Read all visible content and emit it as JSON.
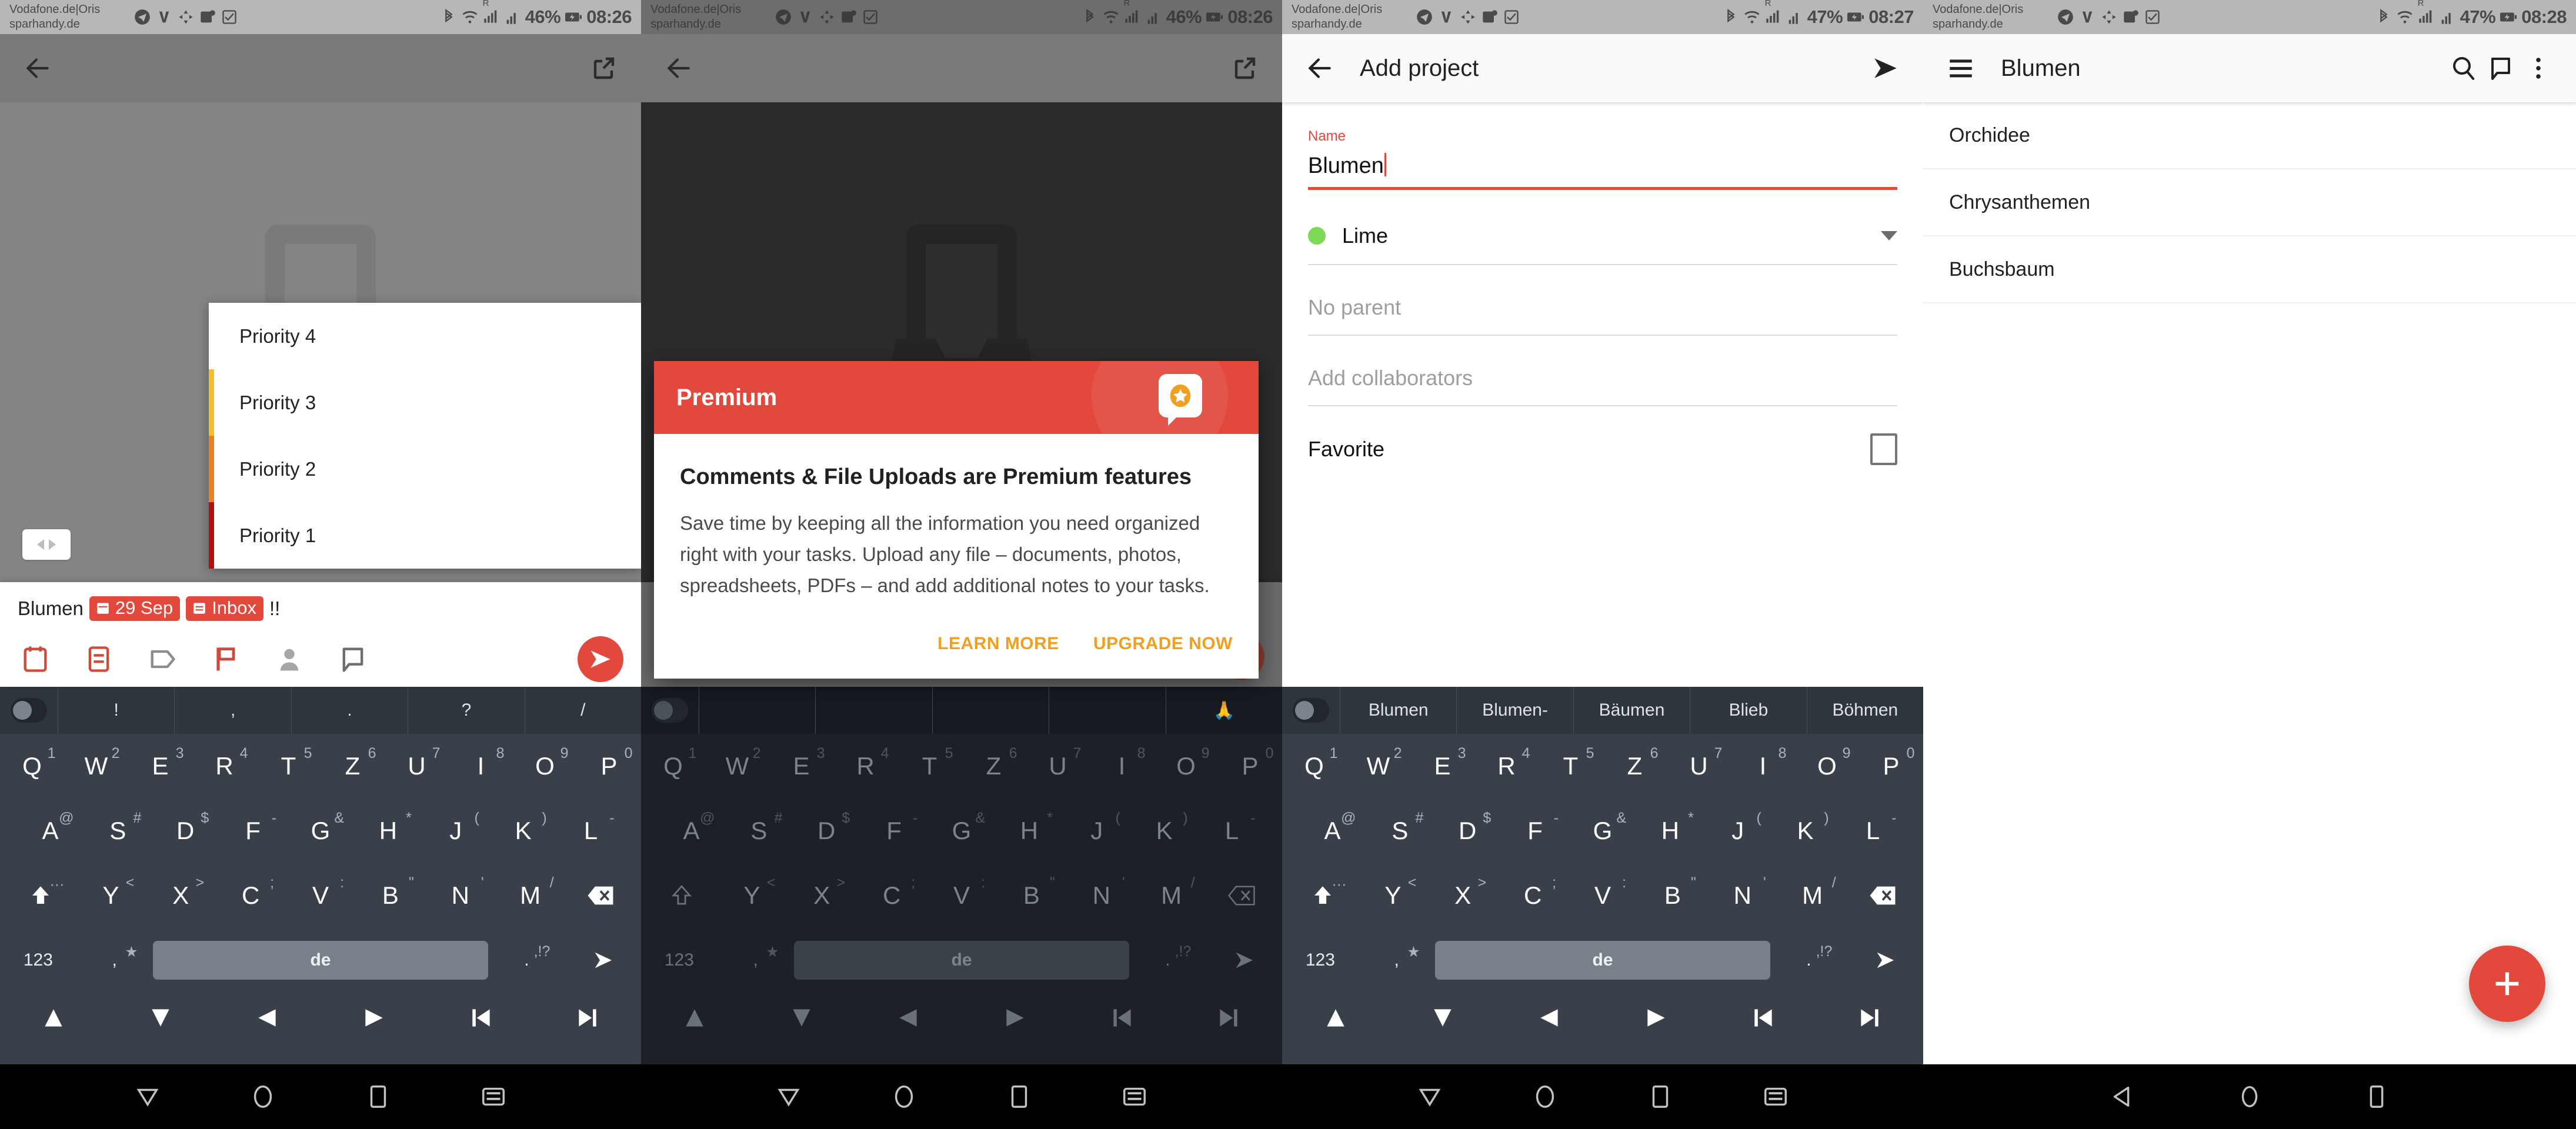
{
  "panels": [
    {
      "status": {
        "carrier_line1": "Vodafone.de|Oris",
        "carrier_line2": "sparhandy.de",
        "battery": "46%",
        "time": "08:26",
        "roaming": "R"
      },
      "appbar": {
        "back_icon": "arrow-back-icon",
        "action_icon": "open-external-icon"
      },
      "priority_menu": {
        "items": [
          {
            "label": "Priority 4",
            "color": "#ffffff"
          },
          {
            "label": "Priority 3",
            "color": "#f3c02c"
          },
          {
            "label": "Priority 2",
            "color": "#ef8021"
          },
          {
            "label": "Priority 1",
            "color": "#b50f0f"
          }
        ]
      },
      "quick_add": {
        "task_text": "Blumen",
        "date_chip": "29 Sep",
        "project_chip": "Inbox",
        "priority_marker": "!!",
        "icons": [
          "calendar-icon",
          "project-icon",
          "label-icon",
          "flag-icon",
          "assignee-icon",
          "comment-icon"
        ],
        "send_icon": "send-icon"
      },
      "keyboard": {
        "suggestions": [
          "!",
          ",",
          ".",
          "?",
          "/"
        ],
        "row1": [
          {
            "k": "Q",
            "s": "1"
          },
          {
            "k": "W",
            "s": "2"
          },
          {
            "k": "E",
            "s": "3"
          },
          {
            "k": "R",
            "s": "4"
          },
          {
            "k": "T",
            "s": "5"
          },
          {
            "k": "Z",
            "s": "6"
          },
          {
            "k": "U",
            "s": "7"
          },
          {
            "k": "I",
            "s": "8"
          },
          {
            "k": "O",
            "s": "9"
          },
          {
            "k": "P",
            "s": "0"
          }
        ],
        "row2": [
          {
            "k": "A",
            "s": "@"
          },
          {
            "k": "S",
            "s": "#"
          },
          {
            "k": "D",
            "s": "$"
          },
          {
            "k": "F",
            "s": "-"
          },
          {
            "k": "G",
            "s": "&"
          },
          {
            "k": "H",
            "s": "*"
          },
          {
            "k": "J",
            "s": "("
          },
          {
            "k": "K",
            "s": ")"
          },
          {
            "k": "L",
            "s": "-"
          }
        ],
        "row3": [
          {
            "k": "Y",
            "s": "<"
          },
          {
            "k": "X",
            "s": ">"
          },
          {
            "k": "C",
            "s": ";"
          },
          {
            "k": "V",
            "s": ":"
          },
          {
            "k": "B",
            "s": "\""
          },
          {
            "k": "N",
            "s": "'"
          },
          {
            "k": "M",
            "s": "/"
          }
        ],
        "shift_label": "⇧",
        "backspace_label": "⌫",
        "dots_label": "···",
        "num_label": "123",
        "comma_label": ",",
        "comma_sup": "★",
        "space_label": "de",
        "period_label": ".",
        "period_sup": ",!?",
        "enter_label": "➤"
      }
    },
    {
      "status": {
        "carrier_line1": "Vodafone.de|Oris",
        "carrier_line2": "sparhandy.de",
        "battery": "46%",
        "time": "08:26",
        "roaming": "R"
      },
      "appbar": {
        "back_icon": "arrow-back-icon",
        "action_icon": "open-external-icon"
      },
      "dialog": {
        "header": "Premium",
        "badge_icon": "premium-star-icon",
        "title": "Comments & File Uploads are Premium features",
        "body": "Save time by keeping all the information you need organized right with your tasks. Upload any file – documents, photos, spreadsheets, PDFs – and add additional notes to your tasks.",
        "learn_more": "LEARN MORE",
        "upgrade_now": "UPGRADE NOW",
        "accent": "#e2493c",
        "action_color": "#f0a020"
      },
      "keyboard": {
        "emoji_suggestion": "🙏"
      }
    },
    {
      "status": {
        "carrier_line1": "Vodafone.de|Oris",
        "carrier_line2": "sparhandy.de",
        "battery": "47%",
        "time": "08:27",
        "roaming": "R"
      },
      "appbar": {
        "back_icon": "arrow-back-icon",
        "title": "Add project",
        "action_icon": "send-icon"
      },
      "form": {
        "name_label": "Name",
        "name_value": "Blumen",
        "color_value": "Lime",
        "color_hex": "#7ed957",
        "parent_placeholder": "No parent",
        "collaborators_placeholder": "Add collaborators",
        "favorite_label": "Favorite",
        "favorite_checked": false
      },
      "keyboard": {
        "suggestions": [
          "Blumen",
          "Blumen-",
          "Bäumen",
          "Blieb",
          "Böhmen"
        ]
      }
    },
    {
      "status": {
        "carrier_line1": "Vodafone.de|Oris",
        "carrier_line2": "sparhandy.de",
        "battery": "47%",
        "time": "08:28",
        "roaming": "R"
      },
      "appbar": {
        "menu_icon": "hamburger-menu-icon",
        "title": "Blumen",
        "search_icon": "search-icon",
        "comment_icon": "comment-icon",
        "overflow_icon": "more-vertical-icon"
      },
      "list": [
        "Orchidee",
        "Chrysanthemen",
        "Buchsbaum"
      ],
      "fab": {
        "icon": "plus-icon",
        "color": "#e2493c"
      }
    }
  ],
  "sysnav": {
    "back_icon": "triangle-back-icon",
    "home_icon": "circle-home-icon",
    "recents_icon": "square-recents-icon",
    "keyboard_icon": "hide-keyboard-icon"
  }
}
